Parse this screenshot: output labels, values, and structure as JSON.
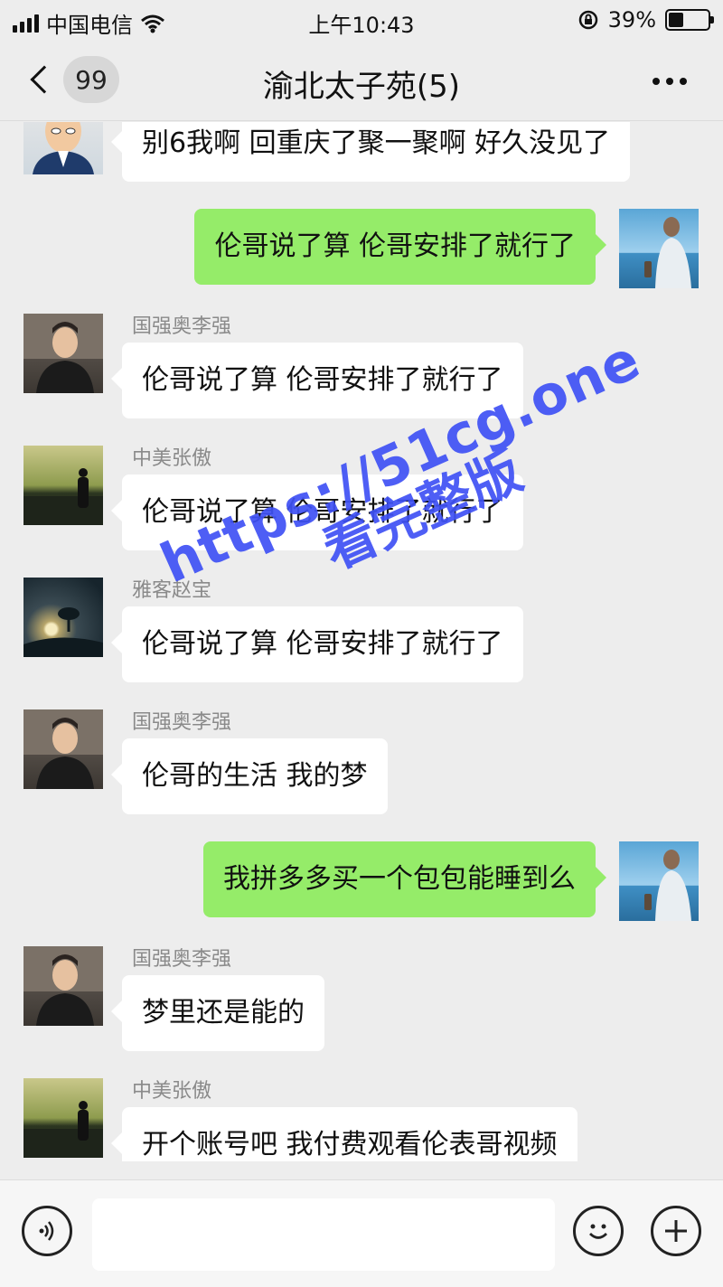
{
  "status_bar": {
    "carrier": "中国电信",
    "time": "上午10:43",
    "battery": "39%",
    "battery_level": 0.39
  },
  "nav": {
    "back_badge": "99",
    "title": "渝北太子苑(5)"
  },
  "messages": [
    {
      "side": "left",
      "sender": "",
      "text": "别6我啊 回重庆了聚一聚啊 好久没见了",
      "avatar": "cartoon-man-icon"
    },
    {
      "side": "right",
      "sender": "",
      "text": "伦哥说了算 伦哥安排了就行了",
      "avatar": "beach-man-icon"
    },
    {
      "side": "left",
      "sender": "国强奥李强",
      "text": "伦哥说了算 伦哥安排了就行了",
      "avatar": "man-portrait-icon"
    },
    {
      "side": "left",
      "sender": "中美张傲",
      "text": "伦哥说了算 伦哥安排了就行了",
      "avatar": "sunset-silhouette-icon"
    },
    {
      "side": "left",
      "sender": "雅客赵宝",
      "text": "伦哥说了算 伦哥安排了就行了",
      "avatar": "night-moon-icon"
    },
    {
      "side": "left",
      "sender": "国强奥李强",
      "text": "伦哥的生活 我的梦",
      "avatar": "man-portrait-icon"
    },
    {
      "side": "right",
      "sender": "",
      "text": "我拼多多买一个包包能睡到么",
      "avatar": "beach-man-icon"
    },
    {
      "side": "left",
      "sender": "国强奥李强",
      "text": "梦里还是能的",
      "avatar": "man-portrait-icon"
    },
    {
      "side": "left",
      "sender": "中美张傲",
      "text": "开个账号吧 我付费观看伦表哥视频",
      "avatar": "sunset-silhouette-icon"
    }
  ],
  "watermark": {
    "line1": "https://51cg.one",
    "line2": "看完整版"
  },
  "input_bar": {
    "voice_icon": "voice-icon",
    "emoji_icon": "emoji-icon",
    "plus_icon": "plus-icon"
  },
  "colors": {
    "background": "#ededed",
    "incoming_bubble": "#ffffff",
    "outgoing_bubble": "#95ec69",
    "watermark": "#3f51f5"
  }
}
